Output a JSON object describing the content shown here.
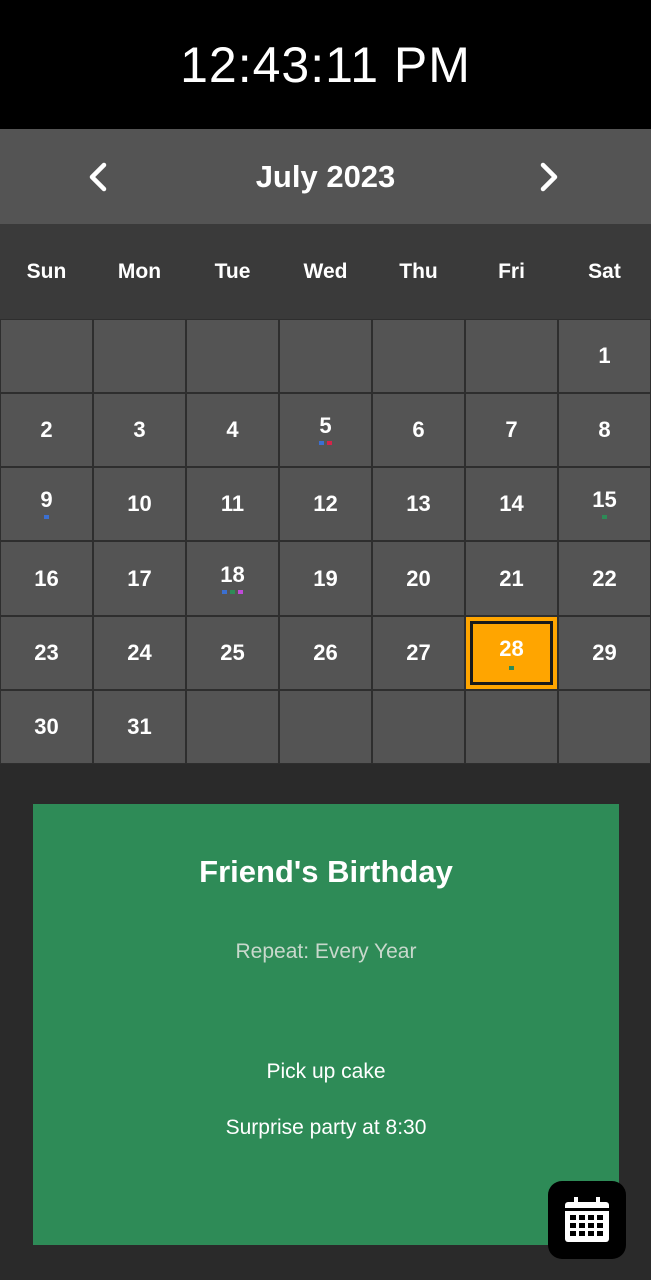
{
  "clock": {
    "time": "12:43:11 PM"
  },
  "header": {
    "month_label": "July 2023",
    "prev_icon": "chevron-left-icon",
    "next_icon": "chevron-right-icon"
  },
  "weekdays": [
    "Sun",
    "Mon",
    "Tue",
    "Wed",
    "Thu",
    "Fri",
    "Sat"
  ],
  "calendar": {
    "selected_day": "28",
    "selected_color": "#ffa500",
    "days": [
      {
        "label": "",
        "dots": []
      },
      {
        "label": "",
        "dots": []
      },
      {
        "label": "",
        "dots": []
      },
      {
        "label": "",
        "dots": []
      },
      {
        "label": "",
        "dots": []
      },
      {
        "label": "",
        "dots": []
      },
      {
        "label": "1",
        "dots": []
      },
      {
        "label": "2",
        "dots": []
      },
      {
        "label": "3",
        "dots": []
      },
      {
        "label": "4",
        "dots": []
      },
      {
        "label": "5",
        "dots": [
          "#3b6fd1",
          "#d6244a"
        ]
      },
      {
        "label": "6",
        "dots": []
      },
      {
        "label": "7",
        "dots": []
      },
      {
        "label": "8",
        "dots": []
      },
      {
        "label": "9",
        "dots": [
          "#3b6fd1"
        ]
      },
      {
        "label": "10",
        "dots": []
      },
      {
        "label": "11",
        "dots": []
      },
      {
        "label": "12",
        "dots": []
      },
      {
        "label": "13",
        "dots": []
      },
      {
        "label": "14",
        "dots": []
      },
      {
        "label": "15",
        "dots": [
          "#2e8b57"
        ]
      },
      {
        "label": "16",
        "dots": []
      },
      {
        "label": "17",
        "dots": []
      },
      {
        "label": "18",
        "dots": [
          "#3b6fd1",
          "#2e8b57",
          "#c04ad9"
        ]
      },
      {
        "label": "19",
        "dots": []
      },
      {
        "label": "20",
        "dots": []
      },
      {
        "label": "21",
        "dots": []
      },
      {
        "label": "22",
        "dots": []
      },
      {
        "label": "23",
        "dots": []
      },
      {
        "label": "24",
        "dots": []
      },
      {
        "label": "25",
        "dots": []
      },
      {
        "label": "26",
        "dots": []
      },
      {
        "label": "27",
        "dots": []
      },
      {
        "label": "28",
        "dots": [
          "#2e8b57"
        ]
      },
      {
        "label": "29",
        "dots": []
      },
      {
        "label": "30",
        "dots": []
      },
      {
        "label": "31",
        "dots": []
      },
      {
        "label": "",
        "dots": []
      },
      {
        "label": "",
        "dots": []
      },
      {
        "label": "",
        "dots": []
      },
      {
        "label": "",
        "dots": []
      },
      {
        "label": "",
        "dots": []
      }
    ]
  },
  "event": {
    "title": "Friend's Birthday",
    "repeat": "Repeat: Every Year",
    "notes": [
      "Pick up cake",
      "Surprise party at 8:30"
    ],
    "color": "#2e8b57"
  },
  "fab": {
    "icon": "calendar-icon"
  }
}
